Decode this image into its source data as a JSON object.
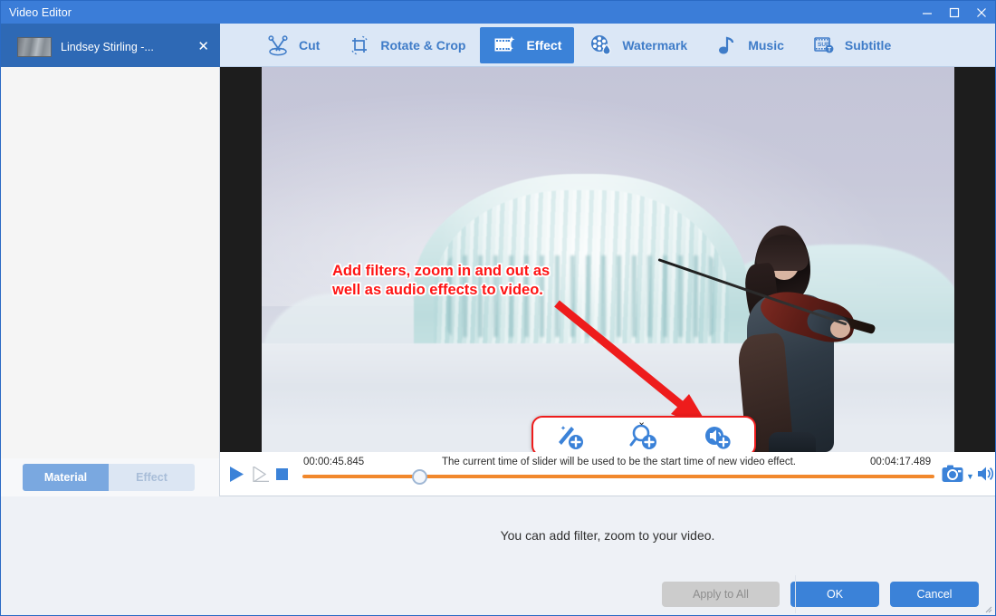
{
  "window": {
    "title": "Video Editor",
    "minimize_label": "minimize",
    "maximize_label": "maximize",
    "close_label": "close",
    "accent": "#3b7dd8"
  },
  "file_tab": {
    "label": "Lindsey Stirling -...",
    "close_label": "✕"
  },
  "toolbar": {
    "items": [
      {
        "label": "Cut",
        "icon": "scissors-icon",
        "active": false
      },
      {
        "label": "Rotate & Crop",
        "icon": "crop-icon",
        "active": false
      },
      {
        "label": "Effect",
        "icon": "film-star-icon",
        "active": true
      },
      {
        "label": "Watermark",
        "icon": "film-drop-icon",
        "active": false
      },
      {
        "label": "Music",
        "icon": "music-note-icon",
        "active": false
      },
      {
        "label": "Subtitle",
        "icon": "subtitle-icon",
        "active": false
      }
    ],
    "active_color": "#3b82d8",
    "text_color": "#3f7cc8"
  },
  "sidebar": {
    "tabs": [
      {
        "label": "Material",
        "active": true
      },
      {
        "label": "Effect",
        "active": false
      }
    ]
  },
  "video": {
    "annotation": "Add filters, zoom in and out as\nwell as audio effects to video.",
    "annotation_color": "#ff1414",
    "effect_popup": {
      "border_color": "#ee1c1c",
      "chevron": "⌄",
      "buttons": [
        {
          "name": "add-filter",
          "icon": "magic-wand-plus-icon"
        },
        {
          "name": "add-zoom",
          "icon": "magnifier-plus-icon"
        },
        {
          "name": "add-audio",
          "icon": "speaker-plus-icon"
        }
      ]
    }
  },
  "player": {
    "current_time": "00:00:45.845",
    "total_time": "00:04:17.489",
    "hint": "The current time of slider will be used to be the start time of new video effect.",
    "progress_percent": 17.8,
    "track_color": "#f1882c",
    "play_label": "play",
    "step_label": "step-forward",
    "stop_label": "stop",
    "snapshot_label": "snapshot",
    "snapshot_caret": "▼",
    "volume_label": "volume"
  },
  "bottom": {
    "message": "You can add filter, zoom to your video."
  },
  "footer": {
    "apply_to_all": "Apply to All",
    "ok": "OK",
    "cancel": "Cancel"
  }
}
